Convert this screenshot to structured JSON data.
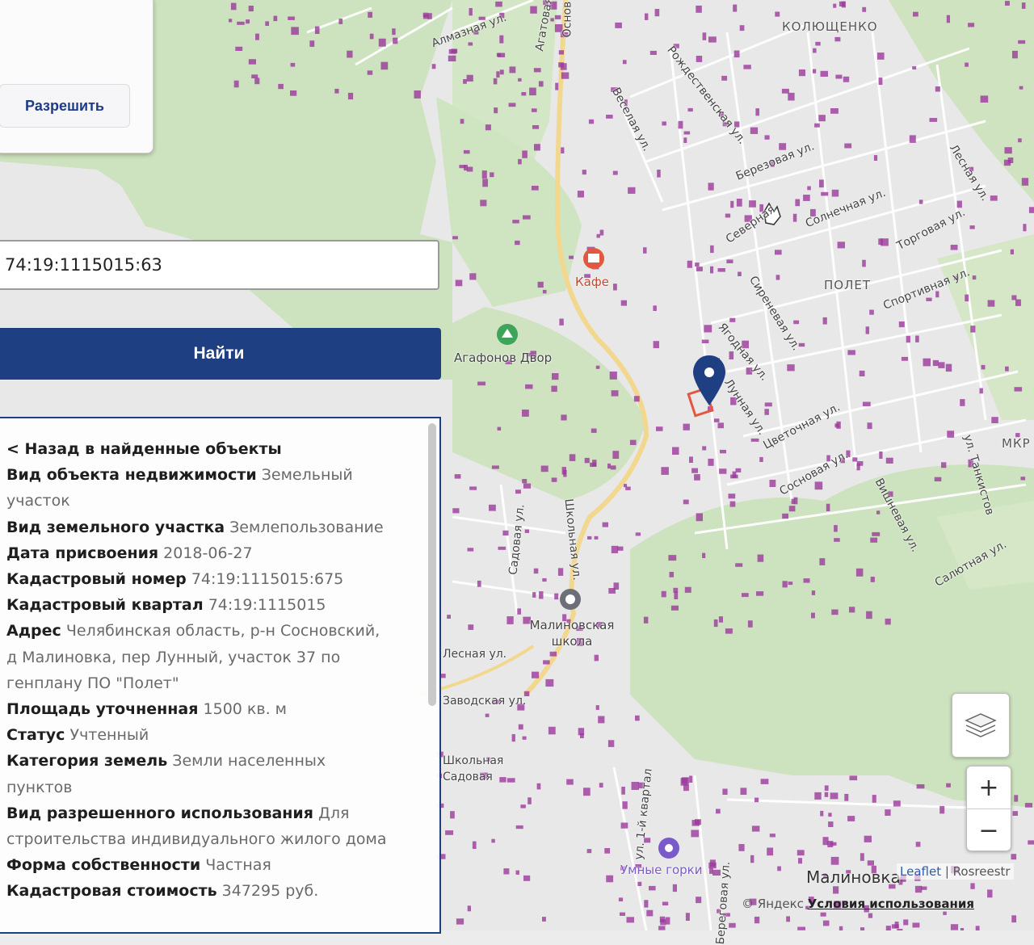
{
  "permission_dialog": {
    "allow_button": "Разрешить"
  },
  "search": {
    "value": "74:19:1115015:63",
    "button_label": "Найти"
  },
  "info": {
    "back_link": "< Назад в найденные объекты",
    "fields": [
      {
        "key": "Вид объекта недвижимости",
        "value": "Земельный участок"
      },
      {
        "key": "Вид земельного участка",
        "value": "Землепользование"
      },
      {
        "key": "Дата присвоения",
        "value": "2018-06-27"
      },
      {
        "key": "Кадастровый номер",
        "value": "74:19:1115015:675"
      },
      {
        "key": "Кадастровый квартал",
        "value": "74:19:1115015"
      },
      {
        "key": "Адрес",
        "value": "Челябинская область, р-н Сосновский, д Малиновка, пер Лунный, участок 37 по генплану ПО \"Полет\""
      },
      {
        "key": "Площадь уточненная",
        "value": "1500 кв. м"
      },
      {
        "key": "Статус",
        "value": "Учтенный"
      },
      {
        "key": "Категория земель",
        "value": "Земли населенных пунктов"
      },
      {
        "key": "Вид разрешенного использования",
        "value": "Для строительства индивидуального жилого дома"
      },
      {
        "key": "Форма собственности",
        "value": "Частная"
      },
      {
        "key": "Кадастровая стоимость",
        "value": "347295 руб."
      }
    ]
  },
  "map": {
    "colors": {
      "forest": "#cfe3c0",
      "built": "#e6e6e6",
      "road": "#f4d890",
      "building": "#9b3a9b",
      "marker": "#1f3f83",
      "cafe": "#e2583e"
    },
    "districts": [
      "КОЛЮЩЕНКО",
      "ПОЛЕТ",
      "МКР"
    ],
    "streets": [
      "Алмазная ул.",
      "Агатовая",
      "Основ",
      "Рождественская ул.",
      "Веселая ул.",
      "Березовая ул.",
      "Лесная ул.",
      "Северная",
      "Солнечная ул.",
      "Торговая ул.",
      "Сиреневая ул.",
      "Спортивная ул.",
      "Ягодная ул.",
      "Лунная ул.",
      "Цветочная ул.",
      "Сосновая ул.",
      "Вишневая ул.",
      "ул. Танкистов",
      "Салютная ул.",
      "Садовая ул.",
      "Школьная ул.",
      "Лесная ул.",
      "Заводская ул.",
      "ул. 1-й квартал",
      "Береговая ул.",
      "Школьная",
      "Садовая"
    ],
    "pois": {
      "cafe": "Кафе",
      "farm": "Агафонов Двор",
      "school": "Малиновская школа",
      "hills": "Умные горки"
    },
    "city": "Малиновка",
    "attribution": {
      "leaflet": "Leaflet",
      "rosreestr": "Rosreestr",
      "yandex": "© Яндекс",
      "terms": "Условия использования"
    },
    "controls": {
      "zoom_in": "+",
      "zoom_out": "−"
    }
  }
}
